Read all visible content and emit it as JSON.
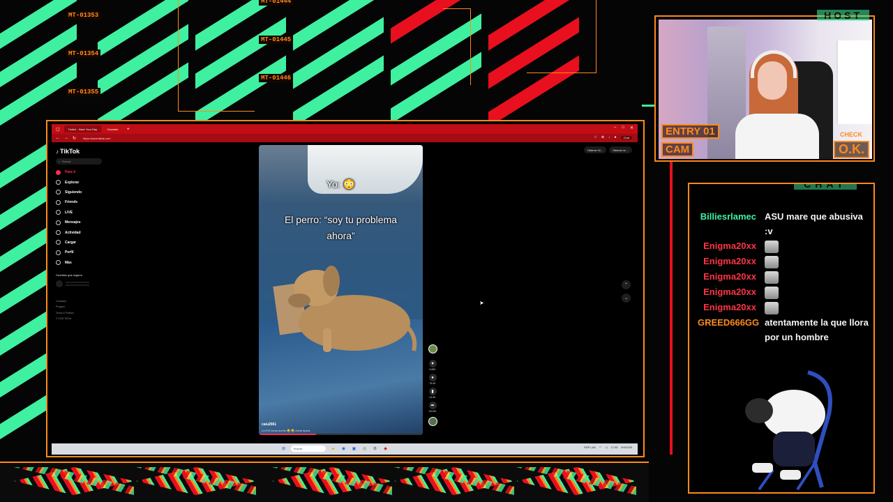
{
  "overlay": {
    "codes": [
      "MT-01353",
      "MT-01354",
      "MT-01355",
      "MT-01444",
      "MT-01445",
      "MT-01446"
    ],
    "colors": {
      "accent": "#ff8a1c",
      "green": "#3ff0a0",
      "red": "#e8101e"
    }
  },
  "browser": {
    "tabs": [
      "Twitch - Have Your Day",
      "Chamber"
    ],
    "url": "https://www.tiktok.com",
    "chat_button": "Chat"
  },
  "tiktok": {
    "logo": "TikTok",
    "search_placeholder": "Buscar",
    "nav": [
      {
        "label": "Para ti",
        "icon": "home-icon",
        "active": true
      },
      {
        "label": "Explorar",
        "icon": "compass-icon"
      },
      {
        "label": "Siguiendo",
        "icon": "following-icon"
      },
      {
        "label": "Friends",
        "icon": "friends-icon"
      },
      {
        "label": "LIVE",
        "icon": "live-icon"
      },
      {
        "label": "Mensajes",
        "icon": "message-icon"
      },
      {
        "label": "Actividad",
        "icon": "bell-icon"
      },
      {
        "label": "Cargar",
        "icon": "upload-icon"
      },
      {
        "label": "Perfil",
        "icon": "profile-icon"
      },
      {
        "label": "Más",
        "icon": "more-icon"
      }
    ],
    "following_title": "Cuentas que sigues",
    "footer": [
      "Company",
      "Program",
      "Terms & Policies",
      "© 2025 TikTok"
    ],
    "top_buttons": [
      "Obtener M...",
      "Obtener la ..."
    ],
    "video": {
      "caption_top": "Yo: 😳",
      "caption_main": "El perro: “soy tu problema ahora”",
      "author": "caiu2961",
      "description": "La PvS tonta dueño 😂 😂 #viral #para",
      "progress": 0.35,
      "likes": "9,89K",
      "comments": "76.4K",
      "saves": "24.9K",
      "shares": "120.6K"
    }
  },
  "taskbar": {
    "search": "Buscar",
    "time": "17:05",
    "date": "8/4/2025",
    "lang": "ESP LAA"
  },
  "host": {
    "label": "HOST",
    "entry": "ENTRY 01",
    "cam": "CAM",
    "check": "CHECK",
    "ok": "O.K."
  },
  "chat": {
    "label": "CHAT",
    "messages": [
      {
        "user": "Billiesrlamec",
        "text": "ASU mare que abusiva :v",
        "color": "#3ff0a0"
      },
      {
        "user": "Enigma20xx",
        "emote": true,
        "color": "#ff3344"
      },
      {
        "user": "Enigma20xx",
        "emote": true,
        "color": "#ff3344"
      },
      {
        "user": "Enigma20xx",
        "emote": true,
        "color": "#ff3344"
      },
      {
        "user": "Enigma20xx",
        "emote": true,
        "color": "#ff3344"
      },
      {
        "user": "Enigma20xx",
        "emote": true,
        "color": "#ff3344"
      },
      {
        "user": "GREED666GG",
        "text": "atentamente la que llora por un hombre",
        "color": "#ff8a1c"
      }
    ]
  }
}
